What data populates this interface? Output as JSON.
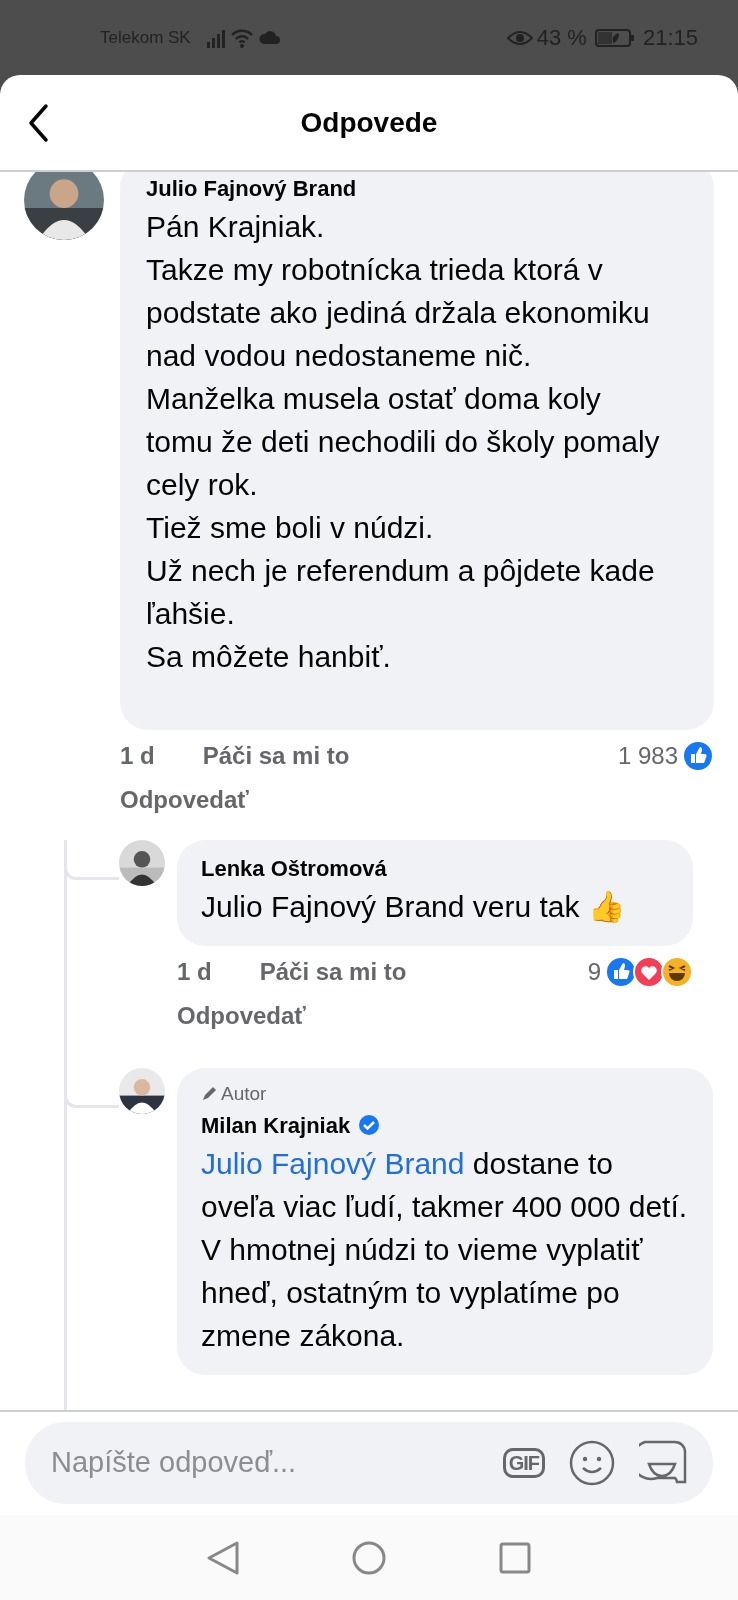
{
  "status_bar": {
    "carrier": "Telekom SK",
    "battery_percent": "43 %",
    "time": "21:15"
  },
  "header": {
    "title": "Odpovede"
  },
  "comment": {
    "author": "Julio Fajnový Brand",
    "paragraphs": [
      "Pán Krajniak.",
      "Takze my robotnícka trieda ktorá v podstate ako jediná držala ekonomiku nad vodou nedostaneme nič.",
      "Manželka musela ostať doma koly tomu že deti nechodili do školy pomaly cely rok.",
      "Tiež sme boli v núdzi.",
      "Už nech je referendum a pôjdete kade ľahšie.",
      "Sa môžete hanbiť."
    ],
    "age": "1 d",
    "like": "Páči sa mi to",
    "reply": "Odpovedať",
    "reaction_count": "1 983",
    "reactions": [
      {
        "kind": "like"
      }
    ]
  },
  "replies": [
    {
      "author": "Lenka Oštromová",
      "verified": false,
      "text": "Julio Fajnový Brand veru tak",
      "emoji": "👍",
      "age": "1 d",
      "like": "Páči sa mi to",
      "reply": "Odpovedať",
      "reaction_count": "9",
      "reactions": [
        {
          "kind": "like"
        },
        {
          "kind": "love"
        },
        {
          "kind": "haha"
        }
      ]
    },
    {
      "author": "Milan Krajniak",
      "author_badge": "Autor",
      "verified": true,
      "mention": "Julio Fajnový Brand",
      "text": "dostane to oveľa viac ľudí, takmer 400 000 detí. V hmotnej núdzi to vieme vyplatiť hneď, ostatným to vyplatíme po zmene zákona."
    }
  ],
  "composer": {
    "placeholder": "Napíšte odpoveď...",
    "gif_label": "GIF"
  }
}
